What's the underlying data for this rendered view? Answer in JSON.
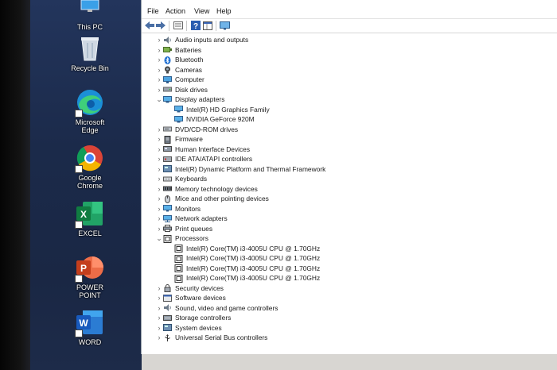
{
  "desktop": {
    "icons": [
      {
        "label": "This PC",
        "icon": "this-pc-icon"
      },
      {
        "label": "Recycle Bin",
        "icon": "recycle-bin-icon"
      },
      {
        "label": "Microsoft Edge",
        "line1": "Microsoft",
        "line2": "Edge",
        "icon": "edge-icon"
      },
      {
        "label": "Google Chrome",
        "line1": "Google",
        "line2": "Chrome",
        "icon": "chrome-icon"
      },
      {
        "label": "EXCEL",
        "icon": "excel-icon"
      },
      {
        "label": "POWER POINT",
        "line1": "POWER",
        "line2": "POINT",
        "icon": "powerpoint-icon"
      },
      {
        "label": "WORD",
        "icon": "word-icon"
      }
    ]
  },
  "menu": {
    "file": "File",
    "action": "Action",
    "view": "View",
    "help": "Help"
  },
  "toolbar": {
    "icons": [
      "back-arrow-icon",
      "forward-arrow-icon",
      "properties-icon",
      "help-icon",
      "console-icon",
      "monitor-icon"
    ]
  },
  "tree": {
    "audio": "Audio inputs and outputs",
    "batteries": "Batteries",
    "bluetooth": "Bluetooth",
    "cameras": "Cameras",
    "computer": "Computer",
    "disk": "Disk drives",
    "display": "Display adapters",
    "display_children": [
      "Intel(R) HD Graphics Family",
      "NVIDIA GeForce 920M"
    ],
    "dvd": "DVD/CD-ROM drives",
    "firmware": "Firmware",
    "hid": "Human Interface Devices",
    "ide": "IDE ATA/ATAPI controllers",
    "intel_dptf": "Intel(R) Dynamic Platform and Thermal Framework",
    "keyboards": "Keyboards",
    "memory": "Memory technology devices",
    "mice": "Mice and other pointing devices",
    "monitors": "Monitors",
    "network": "Network adapters",
    "print": "Print queues",
    "processors": "Processors",
    "processor_children": [
      "Intel(R) Core(TM) i3-4005U CPU @ 1.70GHz",
      "Intel(R) Core(TM) i3-4005U CPU @ 1.70GHz",
      "Intel(R) Core(TM) i3-4005U CPU @ 1.70GHz",
      "Intel(R) Core(TM) i3-4005U CPU @ 1.70GHz"
    ],
    "security": "Security devices",
    "software": "Software devices",
    "sound": "Sound, video and game controllers",
    "storage": "Storage controllers",
    "system": "System devices",
    "usb": "Universal Serial Bus controllers"
  },
  "colors": {
    "selection_blue": "#1f6fd1",
    "excel_green": "#1d7a45",
    "powerpoint_red": "#d24726",
    "word_blue": "#2b5fb4"
  }
}
